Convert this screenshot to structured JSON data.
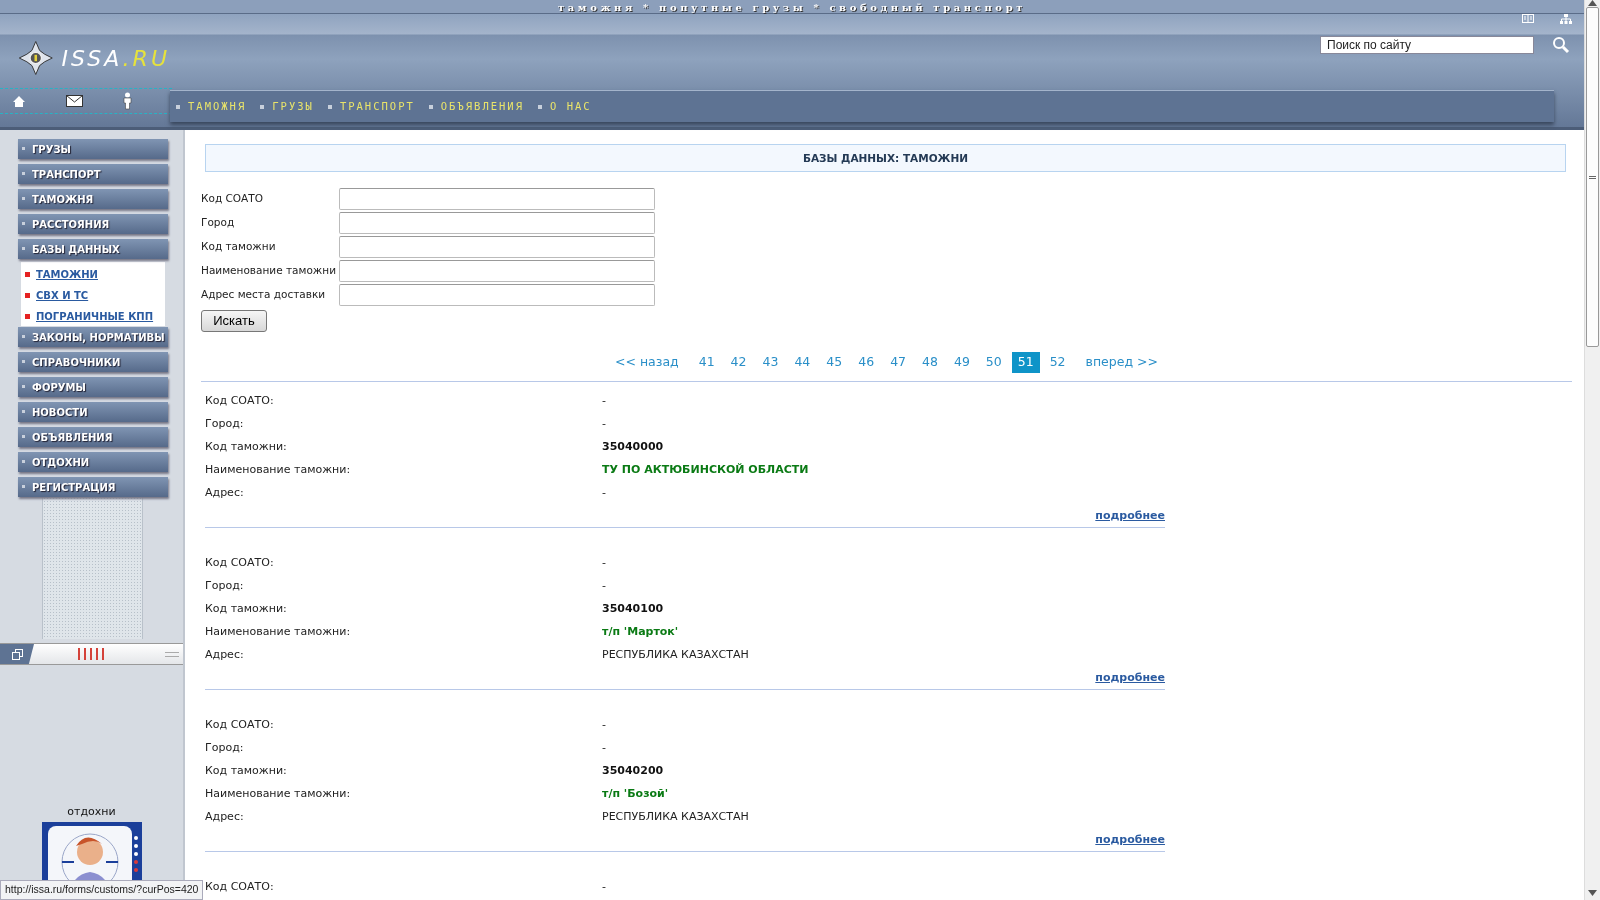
{
  "tagline": "таможня * попутные грузы * свободный транспорт",
  "logo": {
    "name": "ISSA",
    "domain": ".RU"
  },
  "search": {
    "value": "Поиск по сайту"
  },
  "top_nav": [
    "ТАМОЖНЯ",
    "ГРУЗЫ",
    "ТРАНСПОРТ",
    "ОБЪЯВЛЕНИЯ",
    "О НАС"
  ],
  "sidebar": {
    "items": [
      {
        "label": "ГРУЗЫ"
      },
      {
        "label": "ТРАНСПОРТ"
      },
      {
        "label": "ТАМОЖНЯ"
      },
      {
        "label": "РАССТОЯНИЯ"
      },
      {
        "label": "БАЗЫ ДАННЫХ",
        "children": [
          {
            "label": "ТАМОЖНИ"
          },
          {
            "label": "СВХ И ТС"
          },
          {
            "label": "ПОГРАНИЧНЫЕ КПП"
          }
        ]
      },
      {
        "label": "ЗАКОНЫ, НОРМАТИВЫ"
      },
      {
        "label": "СПРАВОЧНИКИ"
      },
      {
        "label": "ФОРУМЫ"
      },
      {
        "label": "НОВОСТИ"
      },
      {
        "label": "ОБЪЯВЛЕНИЯ"
      },
      {
        "label": "ОТДОХНИ"
      },
      {
        "label": "РЕГИСТРАЦИЯ"
      }
    ]
  },
  "relax": {
    "caption": "отдохни",
    "kind": "picture"
  },
  "heading": "БАЗЫ ДАННЫХ: ТАМОЖНИ",
  "form": {
    "fields": [
      {
        "label": "Код СОАТО"
      },
      {
        "label": "Город"
      },
      {
        "label": "Код таможни"
      },
      {
        "label": "Наименование таможни"
      },
      {
        "label": "Адрес места доставки"
      }
    ],
    "button": "Искать"
  },
  "pagination": {
    "prev": "<< назад",
    "pages": [
      {
        "label": "41",
        "selected": false
      },
      {
        "label": "42",
        "selected": false
      },
      {
        "label": "43",
        "selected": false
      },
      {
        "label": "44",
        "selected": false
      },
      {
        "label": "45",
        "selected": false
      },
      {
        "label": "46",
        "selected": false
      },
      {
        "label": "47",
        "selected": false
      },
      {
        "label": "48",
        "selected": false
      },
      {
        "label": "49",
        "selected": false
      },
      {
        "label": "50",
        "selected": false
      },
      {
        "label": "51",
        "selected": true
      },
      {
        "label": "52",
        "selected": false
      }
    ],
    "next": "вперед >>"
  },
  "records": [
    {
      "fields": [
        {
          "label": "Код СОАТО:",
          "value": "-",
          "kind": "plain"
        },
        {
          "label": "Город:",
          "value": "-",
          "kind": "plain"
        },
        {
          "label": "Код таможни:",
          "value": "35040000",
          "kind": "code"
        },
        {
          "label": "Наименование таможни:",
          "value": "ТУ ПО АКТЮБИНСКОЙ ОБЛАСТИ",
          "kind": "name"
        },
        {
          "label": "Адрес:",
          "value": "-",
          "kind": "plain"
        }
      ],
      "more": "подробнее"
    },
    {
      "fields": [
        {
          "label": "Код СОАТО:",
          "value": "-",
          "kind": "plain"
        },
        {
          "label": "Город:",
          "value": "-",
          "kind": "plain"
        },
        {
          "label": "Код таможни:",
          "value": "35040100",
          "kind": "code"
        },
        {
          "label": "Наименование таможни:",
          "value": "т/п 'Марток'",
          "kind": "name"
        },
        {
          "label": "Адрес:",
          "value": "РЕСПУБЛИКА КАЗАХСТАН",
          "kind": "plain"
        }
      ],
      "more": "подробнее"
    },
    {
      "fields": [
        {
          "label": "Код СОАТО:",
          "value": "-",
          "kind": "plain"
        },
        {
          "label": "Город:",
          "value": "-",
          "kind": "plain"
        },
        {
          "label": "Код таможни:",
          "value": "35040200",
          "kind": "code"
        },
        {
          "label": "Наименование таможни:",
          "value": "т/п 'Бозой'",
          "kind": "name"
        },
        {
          "label": "Адрес:",
          "value": "РЕСПУБЛИКА КАЗАХСТАН",
          "kind": "plain"
        }
      ],
      "more": "подробнее"
    },
    {
      "fields": [
        {
          "label": "Код СОАТО:",
          "value": "-",
          "kind": "plain"
        }
      ]
    }
  ],
  "status_bar": "http://issa.ru/forms/customs/?curPos=420"
}
